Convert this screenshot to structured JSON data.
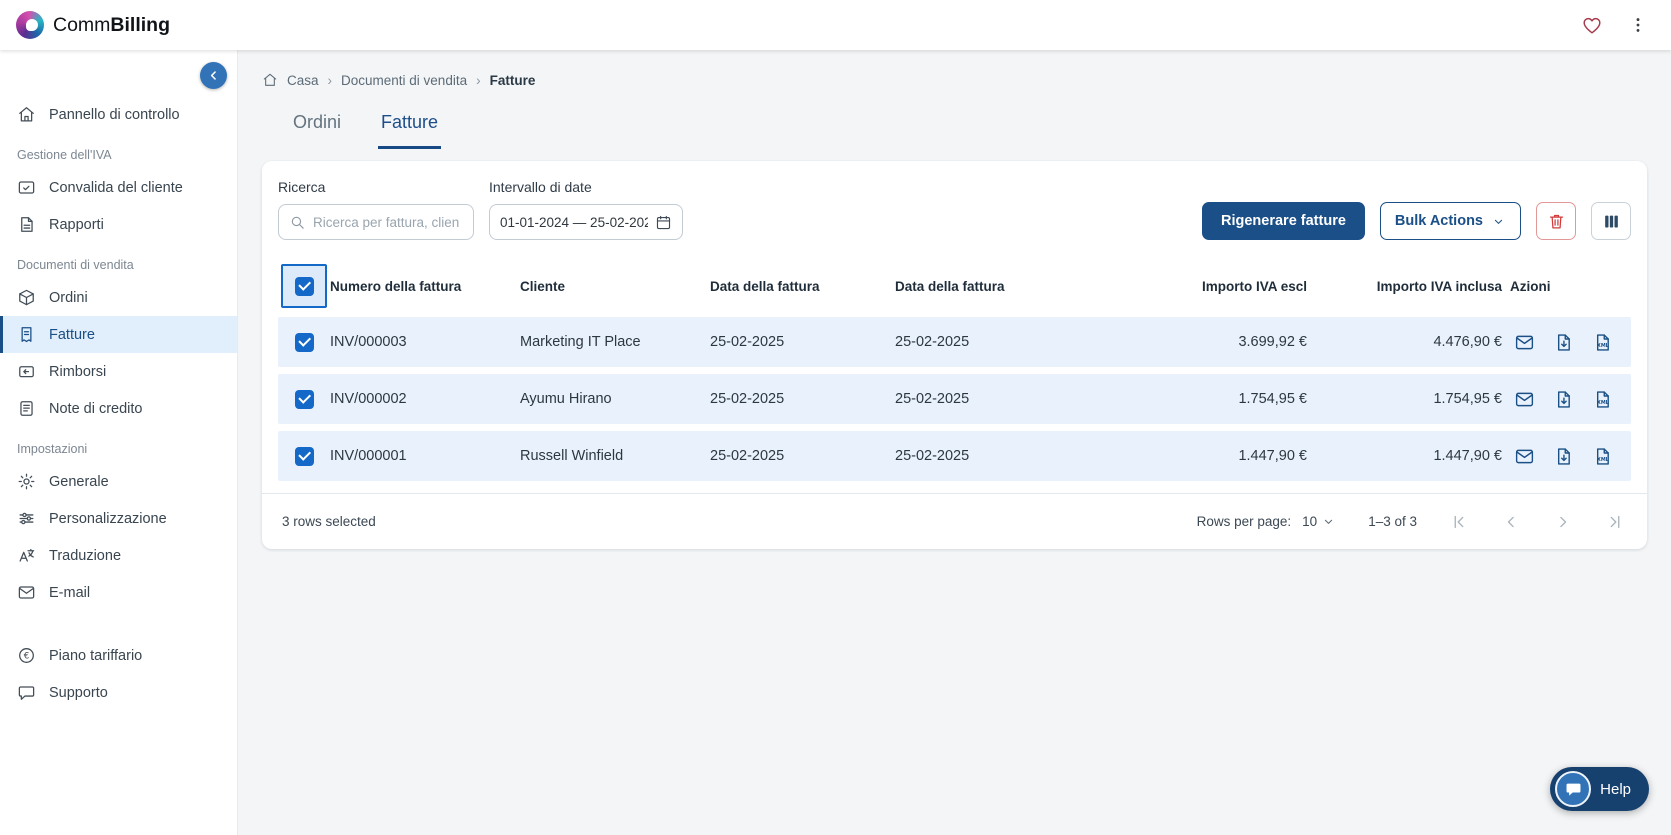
{
  "topbar": {
    "brand": {
      "part1": "Comm",
      "part2": "Billing"
    }
  },
  "sidebar": {
    "sections": [
      {
        "items": [
          {
            "label": "Pannello di controllo",
            "icon": "home-icon"
          }
        ]
      },
      {
        "header": "Gestione dell'IVA",
        "items": [
          {
            "label": "Convalida del cliente",
            "icon": "id-card-check-icon"
          },
          {
            "label": "Rapporti",
            "icon": "report-icon"
          }
        ]
      },
      {
        "header": "Documenti di vendita",
        "items": [
          {
            "label": "Ordini",
            "icon": "orders-box-icon"
          },
          {
            "label": "Fatture",
            "icon": "invoice-icon",
            "active": true
          },
          {
            "label": "Rimborsi",
            "icon": "refund-icon"
          },
          {
            "label": "Note di credito",
            "icon": "credit-note-icon"
          }
        ]
      },
      {
        "header": "Impostazioni",
        "items": [
          {
            "label": "Generale",
            "icon": "gear-icon"
          },
          {
            "label": "Personalizzazione",
            "icon": "sliders-icon"
          },
          {
            "label": "Traduzione",
            "icon": "translate-icon"
          },
          {
            "label": "E-mail",
            "icon": "envelope-icon"
          }
        ]
      }
    ],
    "footer_items": [
      {
        "label": "Piano tariffario",
        "icon": "euro-circle-icon"
      },
      {
        "label": "Supporto",
        "icon": "chat-icon"
      }
    ]
  },
  "breadcrumb": {
    "separator": "›",
    "items": [
      "Casa",
      "Documenti di vendita",
      "Fatture"
    ]
  },
  "tabs": [
    {
      "label": "Ordini"
    },
    {
      "label": "Fatture",
      "active": true
    }
  ],
  "filters": {
    "search_label": "Ricerca",
    "search_placeholder": "Ricerca per fattura, clien",
    "date_label": "Intervallo di date",
    "date_value": "01-01-2024 — 25-02-202",
    "regenerate_label": "Rigenerare fatture",
    "bulk_actions_label": "Bulk Actions"
  },
  "table": {
    "columns": [
      "Numero della fattura",
      "Cliente",
      "Data della fattura",
      "Data della fattura",
      "Importo IVA escl",
      "Importo IVA inclusa",
      "Azioni"
    ],
    "rows": [
      {
        "invoice": "INV/000003",
        "client": "Marketing IT Place",
        "date1": "25-02-2025",
        "date2": "25-02-2025",
        "amount_excl": "3.699,92 €",
        "amount_incl": "4.476,90 €"
      },
      {
        "invoice": "INV/000002",
        "client": "Ayumu Hirano",
        "date1": "25-02-2025",
        "date2": "25-02-2025",
        "amount_excl": "1.754,95 €",
        "amount_incl": "1.754,95 €"
      },
      {
        "invoice": "INV/000001",
        "client": "Russell Winfield",
        "date1": "25-02-2025",
        "date2": "25-02-2025",
        "amount_excl": "1.447,90 €",
        "amount_incl": "1.447,90 €"
      }
    ]
  },
  "table_footer": {
    "selected_text": "3 rows selected",
    "rows_per_page_label": "Rows per page:",
    "rows_per_page_value": "10",
    "range_text": "1–3 of 3"
  },
  "help": {
    "label": "Help"
  },
  "colors": {
    "primary_blue": "#1a4f87",
    "checkbox_blue": "#1468c8",
    "selected_row_bg": "#e9f2fc",
    "danger_red": "#d03b3b"
  }
}
